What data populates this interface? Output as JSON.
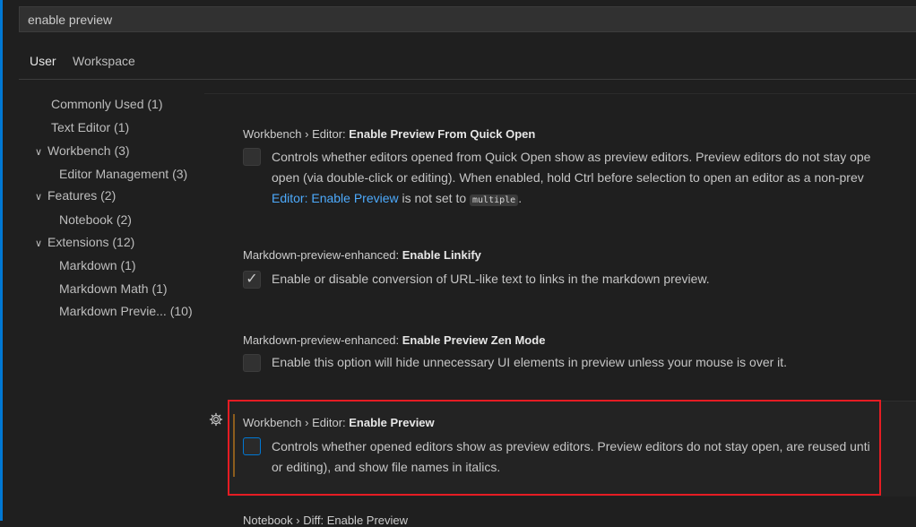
{
  "search": {
    "value": "enable preview"
  },
  "tabs": [
    {
      "label": "User"
    },
    {
      "label": "Workspace"
    }
  ],
  "toc": [
    {
      "label": "Commonly Used (1)",
      "chevron": false
    },
    {
      "label": "Text Editor (1)",
      "chevron": false
    },
    {
      "label": "Workbench (3)",
      "chevron": true
    },
    {
      "label": "Editor Management (3)",
      "chevron": false
    },
    {
      "label": "Features (2)",
      "chevron": true
    },
    {
      "label": "Notebook (2)",
      "chevron": false
    },
    {
      "label": "Extensions (12)",
      "chevron": true
    },
    {
      "label": "Markdown (1)",
      "chevron": false
    },
    {
      "label": "Markdown Math (1)",
      "chevron": false
    },
    {
      "label": "Markdown Previe... (10)",
      "chevron": false
    }
  ],
  "settings": [
    {
      "category": "Workbench › Editor: ",
      "name": "Enable Preview From Quick Open",
      "checked": false,
      "desc_line1": "Controls whether editors opened from Quick Open show as preview editors. Preview editors do not stay ope",
      "desc_line2": "open (via double-click or editing). When enabled, hold Ctrl before selection to open an editor as a non-prev",
      "desc_link": "Editor: Enable Preview",
      "desc_mid": " is not set to ",
      "desc_code": "multiple",
      "desc_end": "."
    },
    {
      "category": "Markdown-preview-enhanced: ",
      "name": "Enable Linkify",
      "checked": true,
      "desc_line1": "Enable or disable conversion of URL-like text to links in the markdown preview."
    },
    {
      "category": "Markdown-preview-enhanced: ",
      "name": "Enable Preview Zen Mode",
      "checked": false,
      "desc_line1": "Enable this option will hide unnecessary UI elements in preview unless your mouse is over it."
    },
    {
      "category": "Workbench › Editor: ",
      "name": "Enable Preview",
      "checked": false,
      "desc_line1": "Controls whether opened editors show as preview editors. Preview editors do not stay open, are reused unti",
      "desc_line2": "or editing), and show file names in italics."
    }
  ],
  "partial_next": {
    "label": "Notebook › Diff: Enable Preview"
  },
  "icons": {
    "gear": "gear-icon",
    "chevron": "chevron-down-icon",
    "check": "check-icon"
  },
  "colors": {
    "accent": "#0078d4",
    "highlight_border": "#e51c23",
    "modified": "#8b5d1d",
    "link": "#4daafc"
  }
}
